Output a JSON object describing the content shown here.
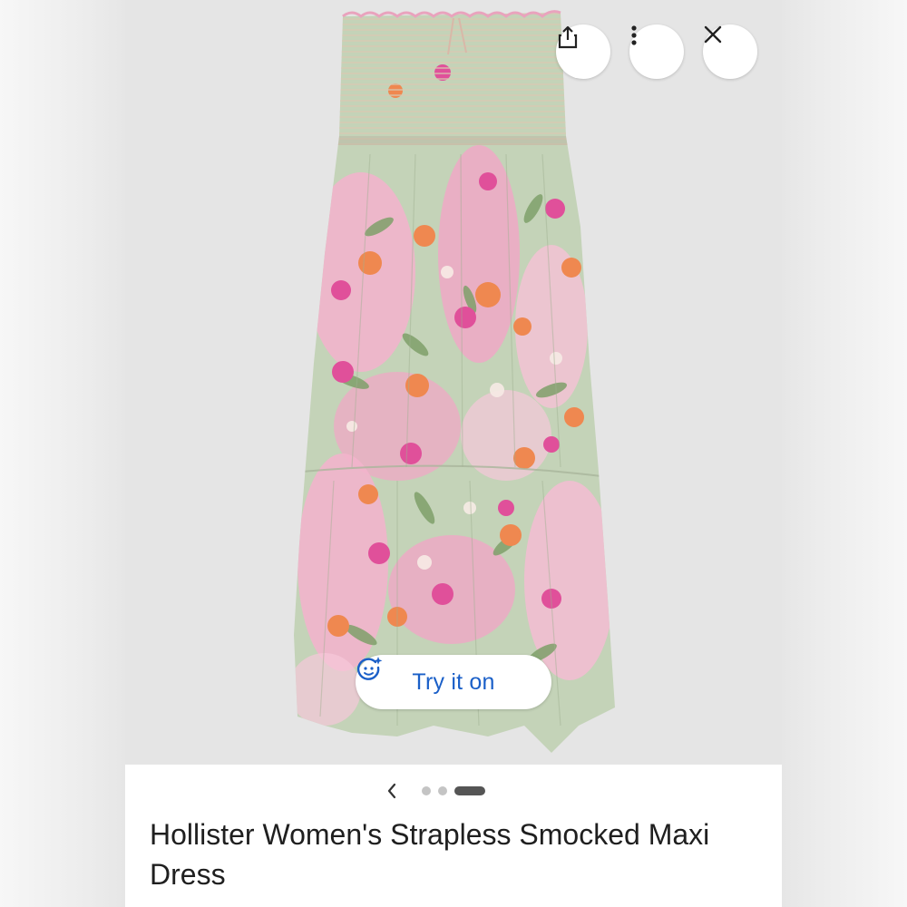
{
  "product": {
    "title": "Hollister Women's Strapless Smocked Maxi Dress",
    "image_alt": "Floral strapless smocked maxi dress in pink and sage green"
  },
  "actions": {
    "share_icon": "share-icon",
    "more_icon": "more-vertical-icon",
    "close_icon": "close-icon"
  },
  "try_on": {
    "label": "Try it on",
    "icon": "try-on-face-sparkle-icon"
  },
  "gallery": {
    "total_images": 3,
    "active_index": 2,
    "prev_icon": "chevron-left-icon"
  },
  "colors": {
    "accent": "#1a5fc8",
    "dress_green": "#c4d3b8",
    "dress_pink": "#f0a8c6",
    "flower_orange": "#ef8850",
    "flower_magenta": "#e0509a"
  }
}
